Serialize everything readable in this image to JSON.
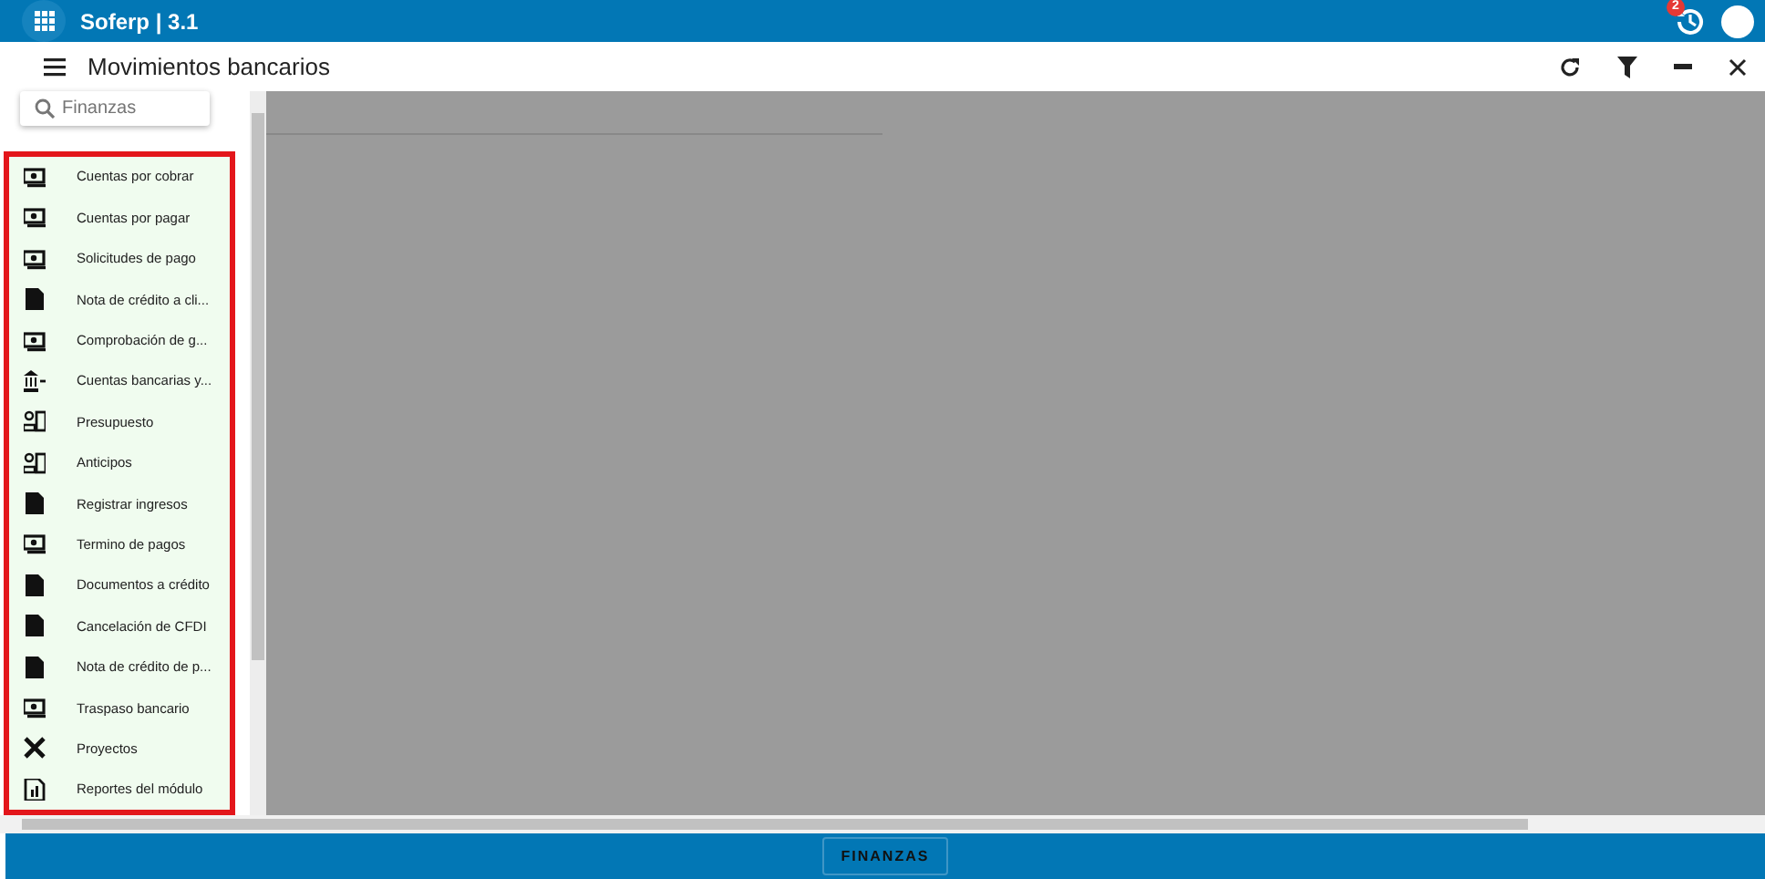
{
  "app_bar": {
    "title": "Soferp | 3.1",
    "notification_count": "2"
  },
  "window": {
    "title": "Movimientos bancarios"
  },
  "search": {
    "placeholder": "Finanzas"
  },
  "menu": {
    "highlighted": true,
    "items": [
      {
        "label": "Cuentas por cobrar"
      },
      {
        "label": "Cuentas por pagar"
      },
      {
        "label": "Solicitudes de pago"
      },
      {
        "label": "Nota de crédito a cli..."
      },
      {
        "label": "Comprobación de g..."
      },
      {
        "label": "Cuentas bancarias y..."
      },
      {
        "label": "Presupuesto"
      },
      {
        "label": "Anticipos"
      },
      {
        "label": "Registrar ingresos"
      },
      {
        "label": "Termino de pagos"
      },
      {
        "label": "Documentos a crédito"
      },
      {
        "label": "Cancelación de CFDI"
      },
      {
        "label": "Nota de crédito de p..."
      },
      {
        "label": "Traspaso bancario"
      },
      {
        "label": "Proyectos"
      },
      {
        "label": "Reportes del módulo"
      }
    ]
  },
  "footer": {
    "button": "FINANZAS"
  }
}
